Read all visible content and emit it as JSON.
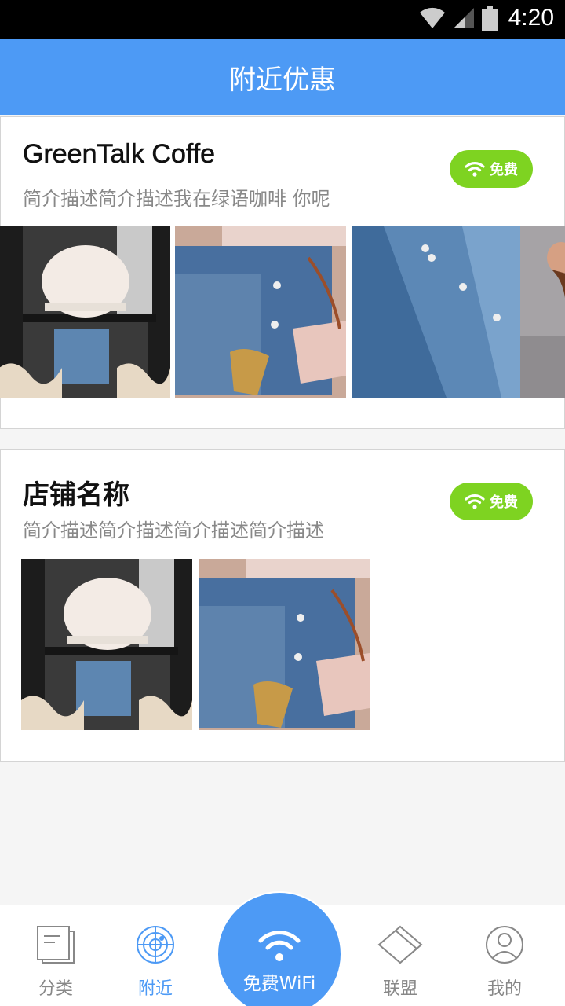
{
  "status": {
    "time": "4:20"
  },
  "header": {
    "title": "附近优惠"
  },
  "shops": [
    {
      "name": "GreenTalk Coffe",
      "desc": "简介描述简介描述我在绿语咖啡 你呢",
      "badge": "免费"
    },
    {
      "name": "店铺名称",
      "desc": "简介描述简介描述简介描述简介描述",
      "badge": "免费"
    }
  ],
  "nav": {
    "items": [
      {
        "label": "分类",
        "icon": "list-icon"
      },
      {
        "label": "附近",
        "icon": "radar-icon",
        "active": true
      },
      {
        "label": "免费WiFi",
        "icon": "wifi-icon"
      },
      {
        "label": "联盟",
        "icon": "diamond-icon"
      },
      {
        "label": "我的",
        "icon": "user-icon"
      }
    ]
  },
  "colors": {
    "primary": "#4d9af5",
    "badge": "#7ed321"
  }
}
